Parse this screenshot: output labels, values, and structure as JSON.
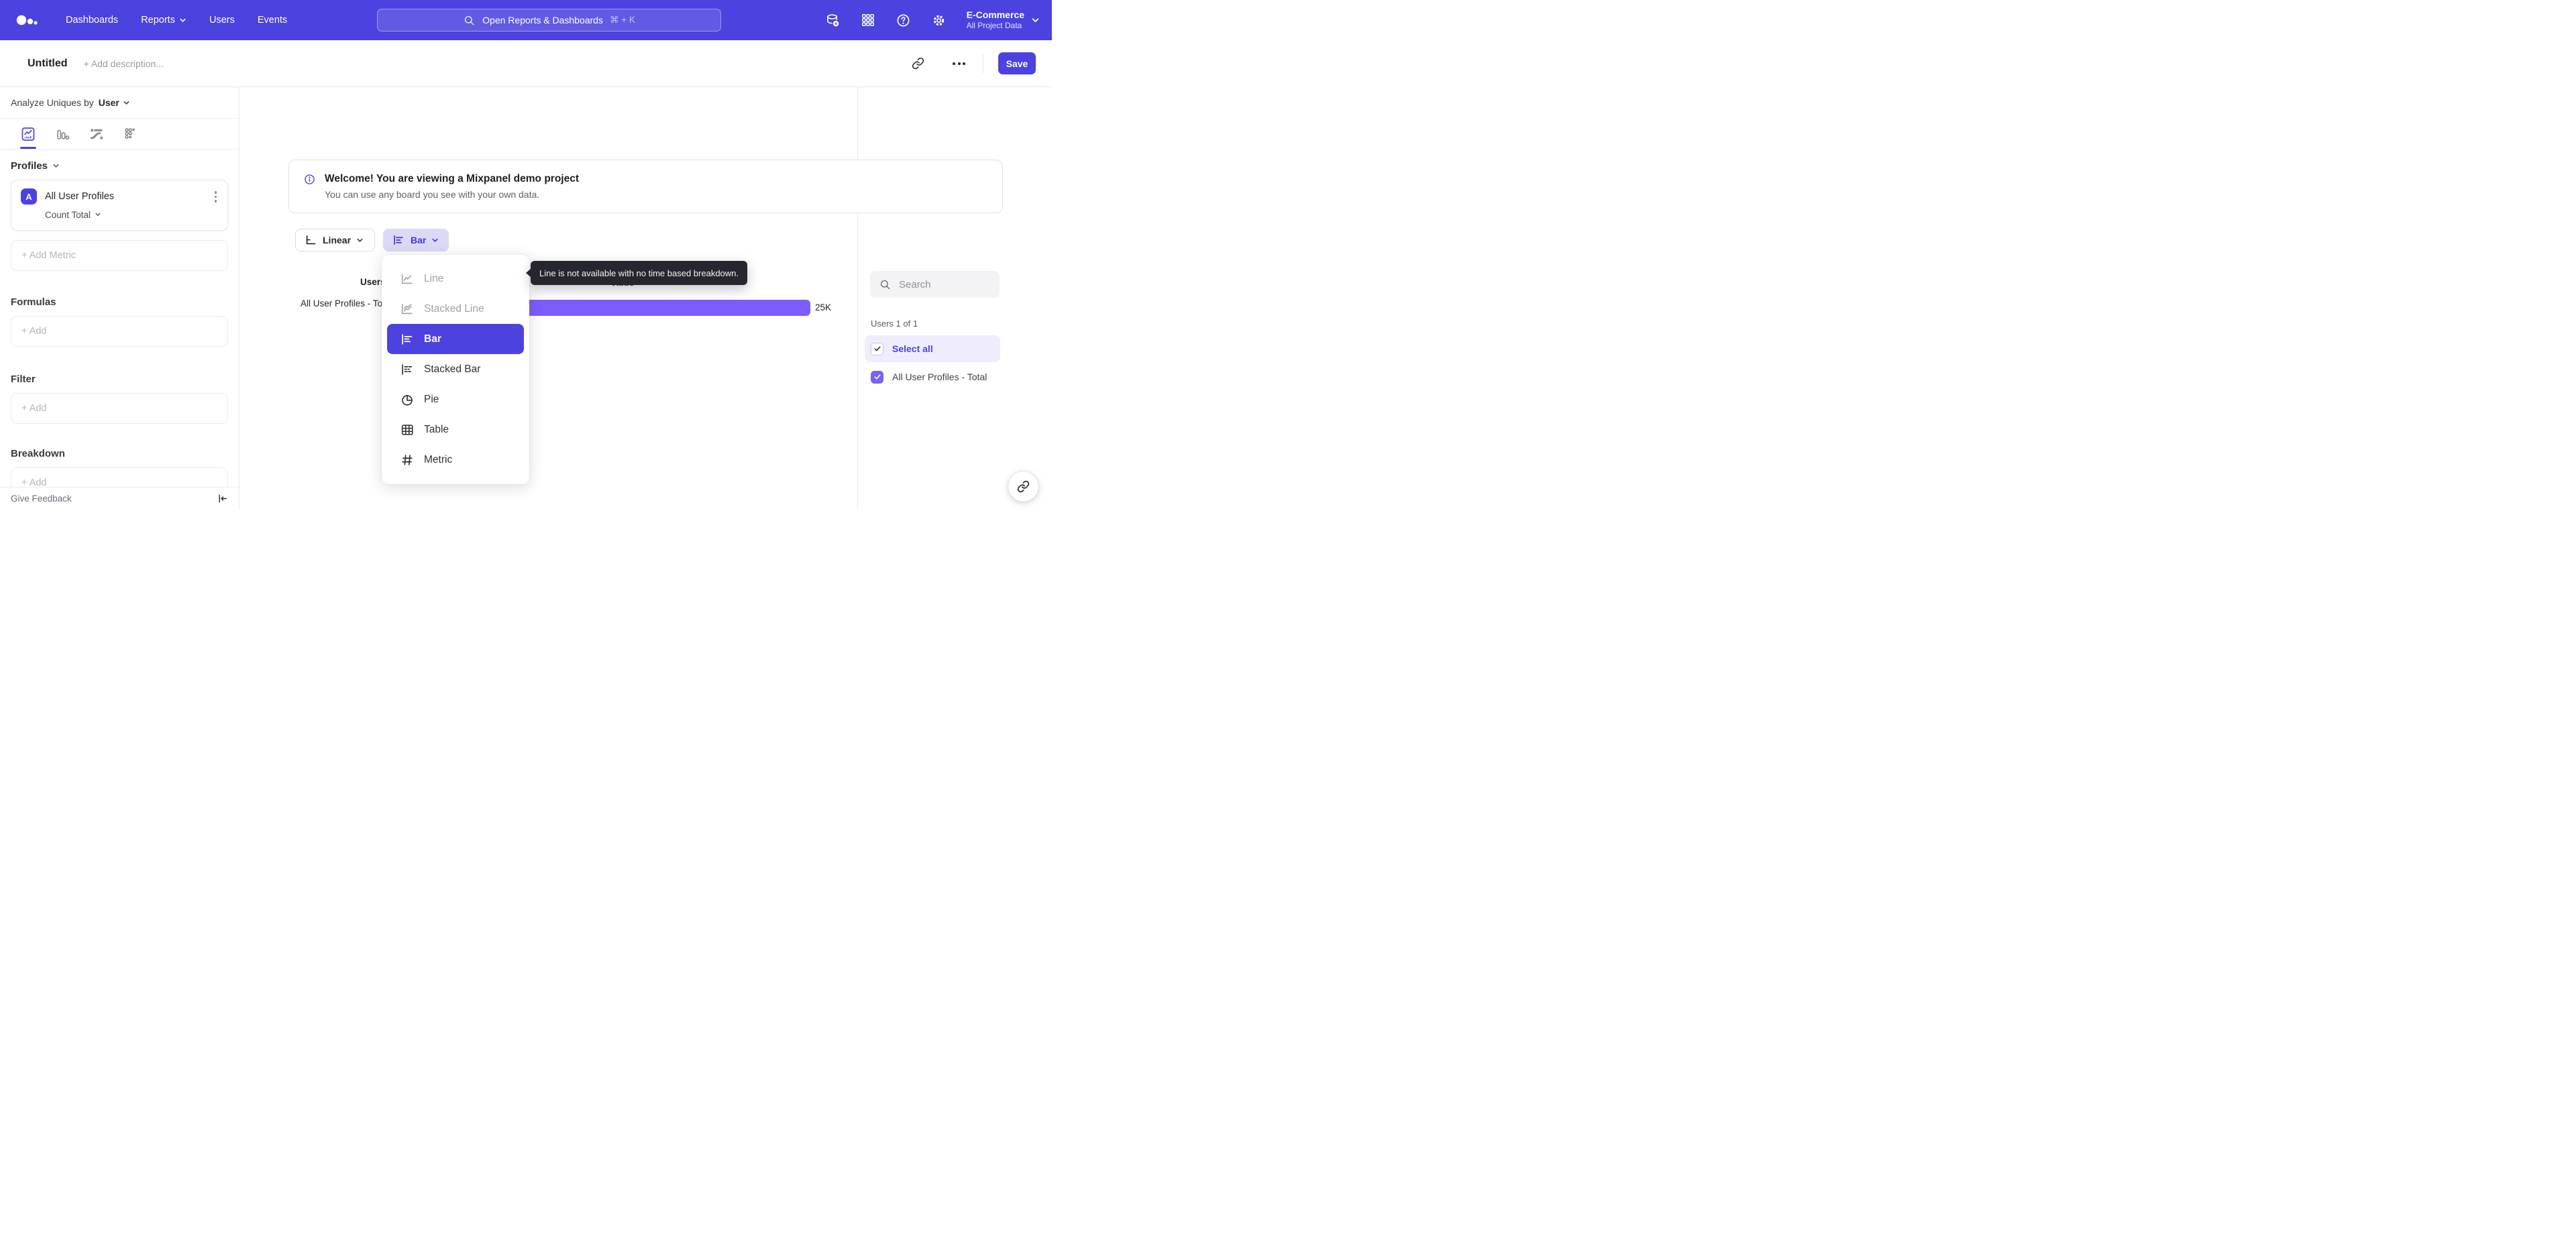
{
  "topnav": {
    "items": [
      {
        "label": "Dashboards"
      },
      {
        "label": "Reports",
        "has_chevron": true
      },
      {
        "label": "Users"
      },
      {
        "label": "Events"
      }
    ],
    "search": {
      "placeholder": "Open Reports & Dashboards",
      "shortcut": "⌘ + K"
    },
    "icons": [
      "data-sources-icon",
      "apps-grid-icon",
      "help-icon",
      "settings-gear-icon"
    ],
    "project": {
      "name": "E-Commerce",
      "scope": "All Project Data"
    }
  },
  "topbar": {
    "title": "Untitled",
    "description_placeholder": "+ Add description...",
    "save_label": "Save"
  },
  "sidebar": {
    "analyze": {
      "prefix": "Analyze Uniques by",
      "selector": "User"
    },
    "tabs": [
      "insights",
      "bar-chart",
      "flows",
      "retention"
    ],
    "active_tab_index": 0,
    "profiles": {
      "header": "Profiles",
      "metric": {
        "badge": "A",
        "name": "All User Profiles",
        "aggregation": "Count Total"
      },
      "add_metric_label": "+ Add Metric"
    },
    "sections": [
      {
        "title": "Formulas",
        "add_label": "+ Add"
      },
      {
        "title": "Filter",
        "add_label": "+ Add"
      },
      {
        "title": "Breakdown",
        "add_label": "+ Add"
      }
    ],
    "footer": {
      "feedback_label": "Give Feedback"
    }
  },
  "banner": {
    "title": "Welcome! You are viewing a Mixpanel demo project",
    "subtitle": "You can use any board you see with your own data."
  },
  "controls": {
    "scale_label": "Linear",
    "chart_type_label": "Bar"
  },
  "chart": {
    "columns": {
      "users": "Users",
      "value": "Value"
    },
    "row_label": "All User Profiles - Total",
    "value_label": "25K"
  },
  "chart_data": {
    "type": "bar",
    "orientation": "horizontal",
    "categories": [
      "All User Profiles - Total"
    ],
    "values": [
      25000
    ],
    "value_labels": [
      "25K"
    ],
    "title": "",
    "xlabel": "Value",
    "ylabel": "Users",
    "grid": false,
    "bar_color": "#7c5cfc"
  },
  "dropdown": {
    "items": [
      {
        "label": "Line",
        "disabled": true
      },
      {
        "label": "Stacked Line",
        "disabled": true
      },
      {
        "label": "Bar",
        "selected": true
      },
      {
        "label": "Stacked Bar"
      },
      {
        "label": "Pie"
      },
      {
        "label": "Table"
      },
      {
        "label": "Metric"
      }
    ]
  },
  "tooltip": {
    "text": "Line is not available with no time based breakdown."
  },
  "right_panel": {
    "search_placeholder": "Search",
    "count_label": "Users 1 of 1",
    "select_all_label": "Select all",
    "series_label": "All User Profiles - Total",
    "select_all_checked": true,
    "series_checked": true
  },
  "colors": {
    "nav_background": "#4b42df",
    "accent": "#4c42e0",
    "chart_bar": "#7c5cfc",
    "chart_type_chip": "#dcd8f8",
    "checkbox_checked": "#7b61f0",
    "tooltip_background": "#26262e"
  }
}
